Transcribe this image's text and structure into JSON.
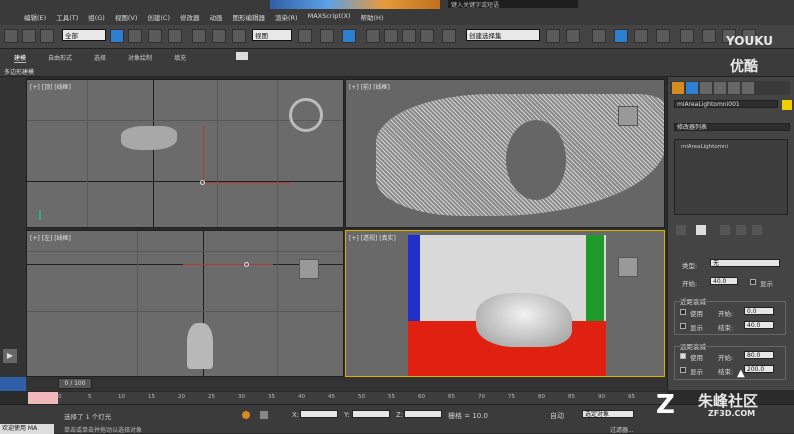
{
  "menu": [
    "编辑(E)",
    "工具(T)",
    "组(G)",
    "视图(V)",
    "创建(C)",
    "修改器",
    "动画",
    "图形编辑器",
    "渲染(R)",
    "MAXScript(X)",
    "帮助(H)"
  ],
  "title": {
    "search_placeholder": "键入关键字或短语"
  },
  "toolbar": {
    "filter_select": "全部",
    "view_select": "视图",
    "named_sel": "创建选择集"
  },
  "ribbon": {
    "tabs": [
      "建模",
      "自由形式",
      "选择",
      "对象绘制",
      "填充"
    ],
    "sub_label": "多边形建模"
  },
  "viewports": {
    "top_left": "[+] [顶] [线框]",
    "top_right": "[+] [前] [线框]",
    "bottom_left": "[+] [左] [线框]",
    "bottom_right": "[+] [透视] [真实]"
  },
  "panel": {
    "object_name": "miAreaLightomni001",
    "modifier_list": "修改器列表",
    "stack_item": "miAreaLightomni",
    "type_label": "类型:",
    "type_value": "无",
    "start_label": "开始:",
    "start_value": "40.0",
    "show_label": "显示",
    "near_title": "近距衰减",
    "use_label": "使用",
    "show2_label": "显示",
    "near_start_label": "开始:",
    "near_start_value": "0.0",
    "near_end_label": "结束:",
    "near_end_value": "40.0",
    "far_title": "远距衰减",
    "far_use_label": "使用",
    "far_show_label": "显示",
    "far_start_label": "开始:",
    "far_start_value": "80.0",
    "far_end_label": "结束:",
    "far_end_value": "200.0"
  },
  "timeline": {
    "frame": "0 / 100",
    "ticks": [
      "0",
      "5",
      "10",
      "15",
      "20",
      "25",
      "30",
      "35",
      "40",
      "45",
      "50",
      "55",
      "60",
      "65",
      "70",
      "75",
      "80",
      "85",
      "90",
      "95",
      "100"
    ]
  },
  "status": {
    "selected": "选择了 1 个灯光",
    "hint": "单击或单击并拖动以选择对象",
    "x_label": "X:",
    "y_label": "Y:",
    "z_label": "Z:",
    "grid": "栅格 = 10.0",
    "auto": "自动",
    "set_key": "选定对象",
    "filter": "过滤器...",
    "welcome": "欢迎使用 MA"
  },
  "watermark": {
    "youku": "YOUKU",
    "youku_cn": "优酷",
    "zf3d": "朱峰社区",
    "zf3d_url": "ZF3D.COM"
  }
}
